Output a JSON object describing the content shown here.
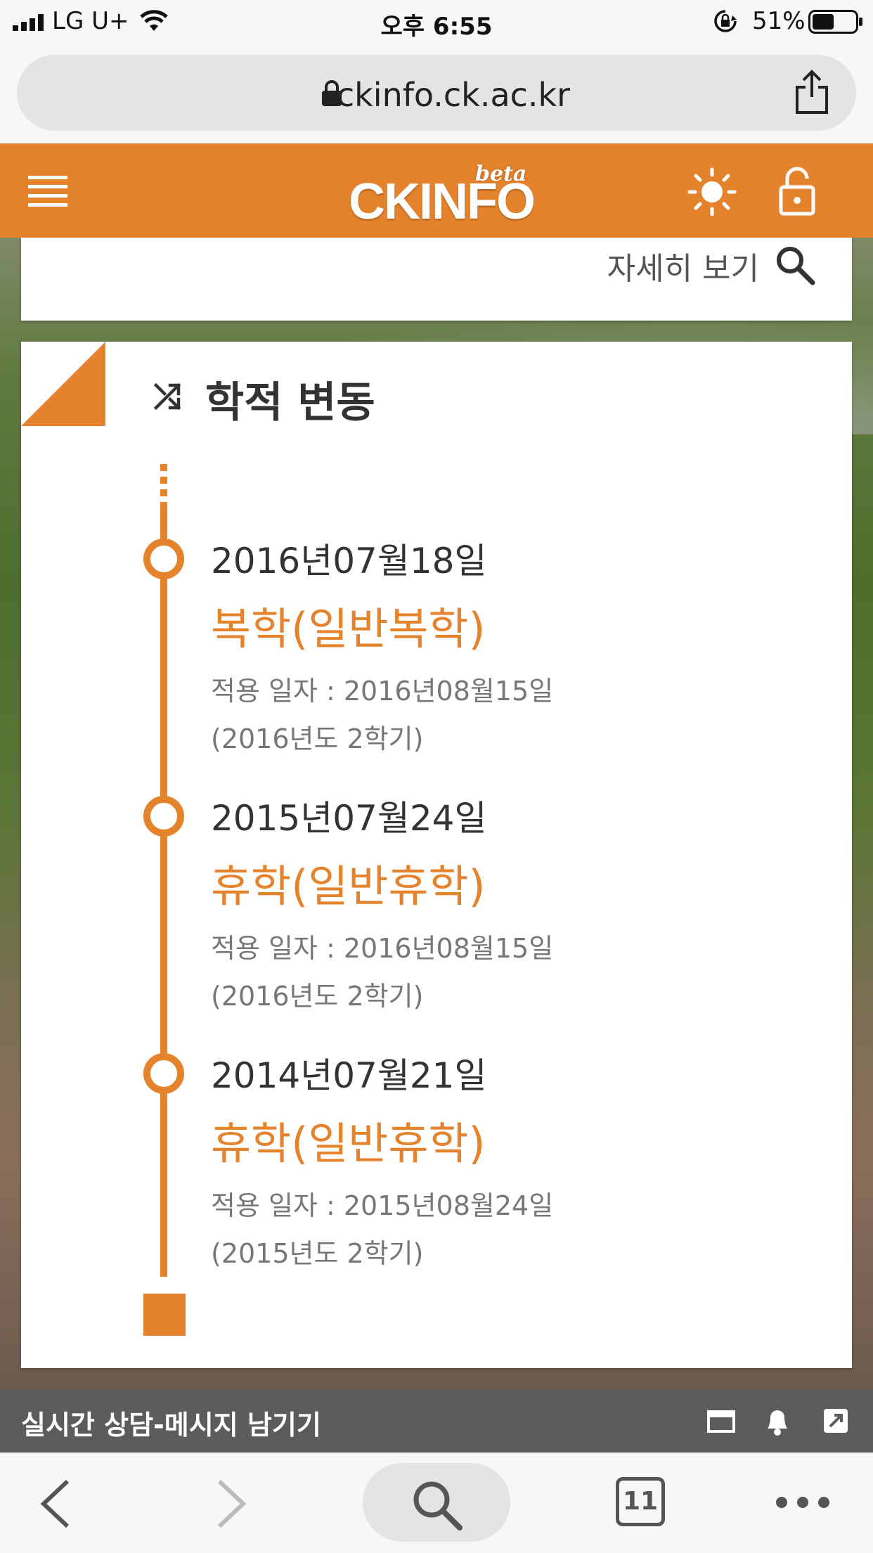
{
  "status_bar": {
    "carrier": "LG U+",
    "time": "오후 6:55",
    "battery_percent": "51%",
    "battery_level": 0.51
  },
  "browser": {
    "url": "ckinfo.ck.ac.kr",
    "tab_count": "11"
  },
  "header": {
    "logo_text": "CKINFO",
    "logo_badge": "beta",
    "brand_color": "#e5822c"
  },
  "top_card": {
    "more_label": "자세히 보기"
  },
  "section": {
    "title": "학적 변동",
    "icon": "shuffle-icon"
  },
  "timeline": [
    {
      "date": "2016년07월18일",
      "change": "복학(일반복학)",
      "apply_date": "적용 일자 : 2016년08월15일",
      "term": "(2016년도 2학기)"
    },
    {
      "date": "2015년07월24일",
      "change": "휴학(일반휴학)",
      "apply_date": "적용 일자 : 2016년08월15일",
      "term": "(2016년도 2학기)"
    },
    {
      "date": "2014년07월21일",
      "change": "휴학(일반휴학)",
      "apply_date": "적용 일자 : 2015년08월24일",
      "term": "(2015년도 2학기)"
    }
  ],
  "chat_bar": {
    "label": "실시간 상담-메시지 남기기"
  }
}
